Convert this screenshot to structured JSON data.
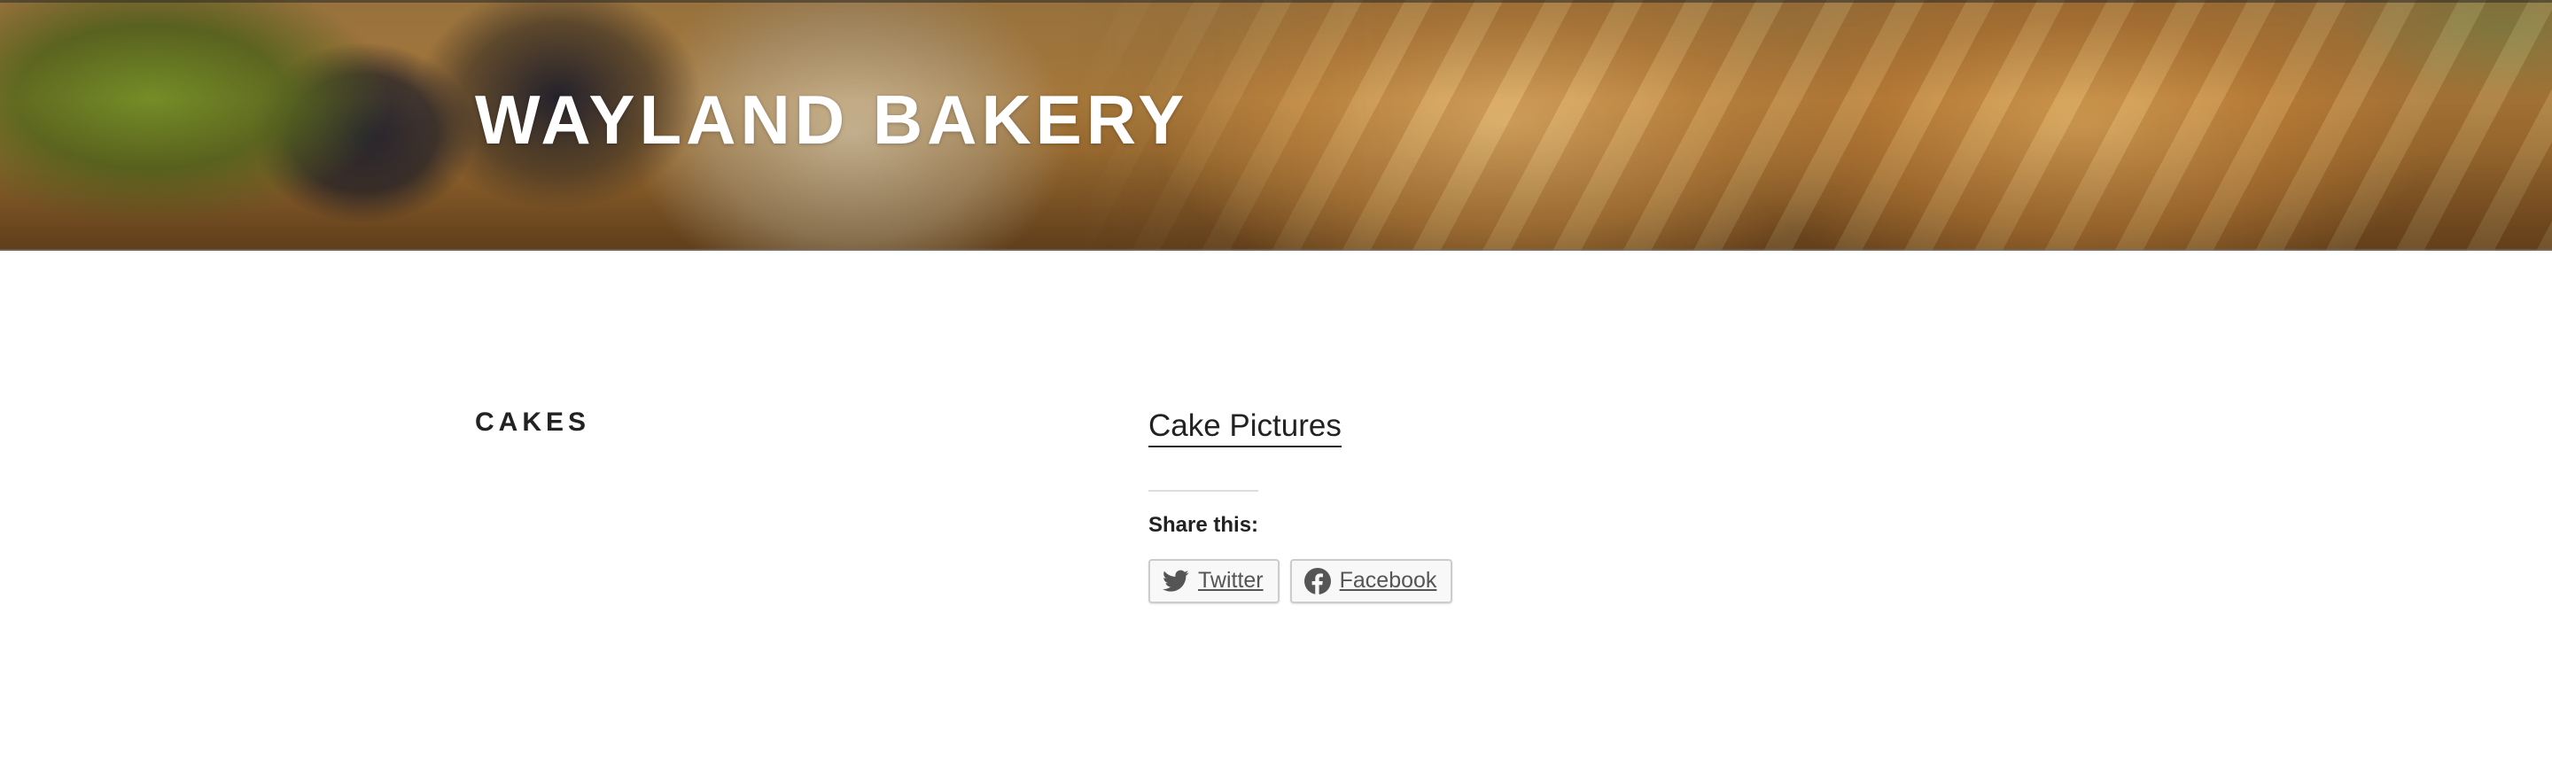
{
  "header": {
    "site_title": "WAYLAND BAKERY"
  },
  "page": {
    "title": "CAKES"
  },
  "entry": {
    "link_text": "Cake Pictures",
    "share": {
      "heading": "Share this:",
      "buttons": [
        {
          "label": "Twitter",
          "icon": "twitter-icon"
        },
        {
          "label": "Facebook",
          "icon": "facebook-icon"
        }
      ]
    }
  },
  "colors": {
    "text": "#222222",
    "header_title": "#ffffff",
    "button_text": "#555555",
    "button_border": "#cccccc",
    "button_bg": "#f8f8f8",
    "divider": "#dddddd"
  }
}
